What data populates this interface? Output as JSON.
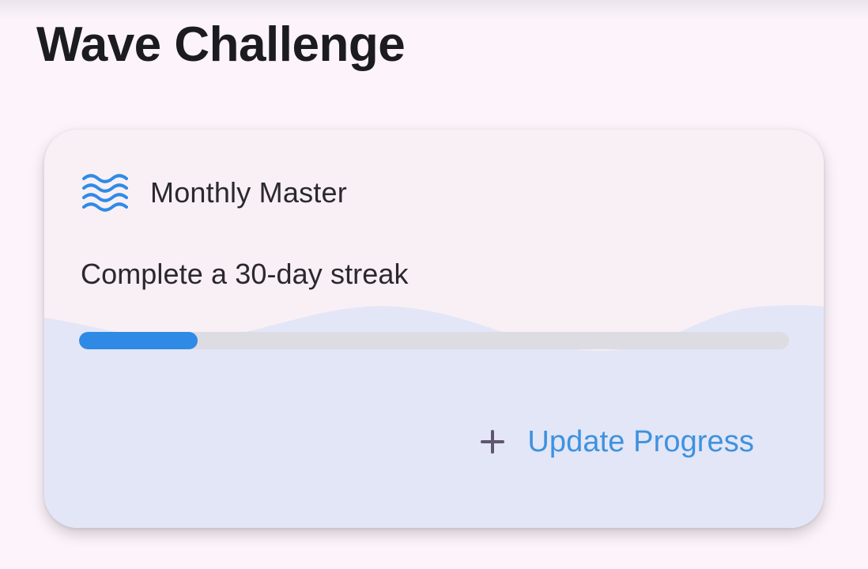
{
  "page": {
    "title": "Wave Challenge"
  },
  "challenge_card": {
    "title": "Monthly Master",
    "description": "Complete a 30-day streak",
    "progress": 0.167,
    "icon": "waves-icon",
    "update_button": {
      "label": "Update Progress",
      "icon": "plus-icon"
    }
  },
  "colors": {
    "background": "#fcf3fb",
    "card_background": "#f8f0f4",
    "wave_fill": "#e3e6f6",
    "progress_fill": "#2f8ae6",
    "progress_track": "#dcdce2",
    "action_text": "#3e92df",
    "plus_icon": "#5f566f"
  }
}
